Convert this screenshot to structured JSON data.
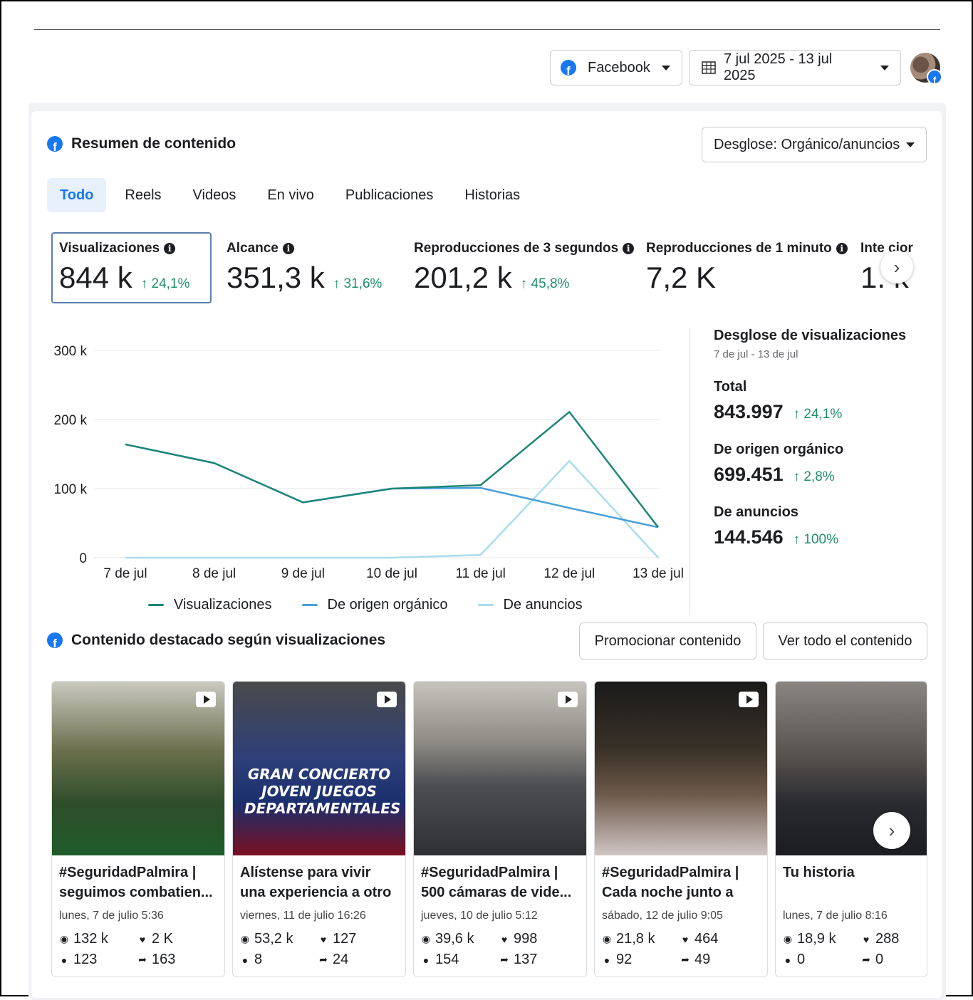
{
  "header": {
    "platform_label": "Facebook",
    "date_range": "7 jul 2025 - 13 jul 2025"
  },
  "summary": {
    "title": "Resumen de contenido",
    "breakdown_button": "Desglose: Orgánico/anuncios",
    "tabs": [
      "Todo",
      "Reels",
      "Videos",
      "En vivo",
      "Publicaciones",
      "Historias"
    ],
    "active_tab": "Todo",
    "metrics": [
      {
        "label": "Visualizaciones",
        "value": "844 k",
        "delta": "↑ 24,1%"
      },
      {
        "label": "Alcance",
        "value": "351,3 k",
        "delta": "↑ 31,6%"
      },
      {
        "label": "Reproducciones de 3 segundos",
        "value": "201,2 k",
        "delta": "↑ 45,8%"
      },
      {
        "label": "Reproducciones de 1 minuto",
        "value": "7,2 K",
        "delta": ""
      },
      {
        "label": "Inte  cior",
        "value": "1.  k",
        "delta": ""
      }
    ]
  },
  "chart_data": {
    "type": "line",
    "x": [
      "7 de jul",
      "8 de jul",
      "9 de jul",
      "10 de jul",
      "11 de jul",
      "12 de jul",
      "13 de jul"
    ],
    "yticks": [
      "300 k",
      "200 k",
      "100 k",
      "0"
    ],
    "ylim": [
      0,
      300000
    ],
    "grid": true,
    "legend": "bottom",
    "series": [
      {
        "name": "Visualizaciones",
        "color": "#1d8677",
        "values": [
          164000,
          137000,
          80000,
          100000,
          105000,
          211000,
          44000
        ]
      },
      {
        "name": "De origen orgánico",
        "color": "#4a9fd8",
        "values": [
          164000,
          137000,
          80000,
          100000,
          101000,
          72000,
          44000
        ]
      },
      {
        "name": "De anuncios",
        "color": "#a8dcef",
        "values": [
          0,
          0,
          0,
          0,
          4000,
          140000,
          0
        ]
      }
    ]
  },
  "breakdown": {
    "title": "Desglose de visualizaciones",
    "range": "7 de jul - 13 de jul",
    "rows": [
      {
        "label": "Total",
        "value": "843.997",
        "delta": "↑ 24,1%"
      },
      {
        "label": "De origen orgánico",
        "value": "699.451",
        "delta": "↑ 2,8%"
      },
      {
        "label": "De anuncios",
        "value": "144.546",
        "delta": "↑ 100%"
      }
    ]
  },
  "featured": {
    "title": "Contenido destacado según visualizaciones",
    "promote_button": "Promocionar contenido",
    "view_all_button": "Ver todo el contenido",
    "posts": [
      {
        "title": "#SeguridadPalmira | seguimos combatien...",
        "date": "lunes, 7 de julio 5:36",
        "views": "132 k",
        "likes": "2 K",
        "comments": "123",
        "shares": "163",
        "thumb_color": "#3d5a2e"
      },
      {
        "title": "Alístense para vivir una experiencia a otro niv...",
        "date": "viernes, 11 de julio 16:26",
        "views": "53,2 k",
        "likes": "127",
        "comments": "8",
        "shares": "24",
        "thumb_color": "#1b2f6e",
        "thumb_text": "GRAN CONCIERTO JOVEN JUEGOS DEPARTAMENTALES"
      },
      {
        "title": "#SeguridadPalmira | 500 cámaras de vide...",
        "date": "jueves, 10 de julio 5:12",
        "views": "39,6 k",
        "likes": "998",
        "comments": "154",
        "shares": "137",
        "thumb_color": "#5a5f66"
      },
      {
        "title": "#SeguridadPalmira | Cada noche junto a la...",
        "date": "sábado, 12 de julio 9:05",
        "views": "21,8 k",
        "likes": "464",
        "comments": "92",
        "shares": "49",
        "thumb_color": "#2a2520"
      },
      {
        "title": "Tu historia",
        "date": "lunes, 7 de julio 8:16",
        "views": "18,9 k",
        "likes": "288",
        "comments": "0",
        "shares": "0",
        "thumb_color": "#6e6a66"
      }
    ]
  }
}
